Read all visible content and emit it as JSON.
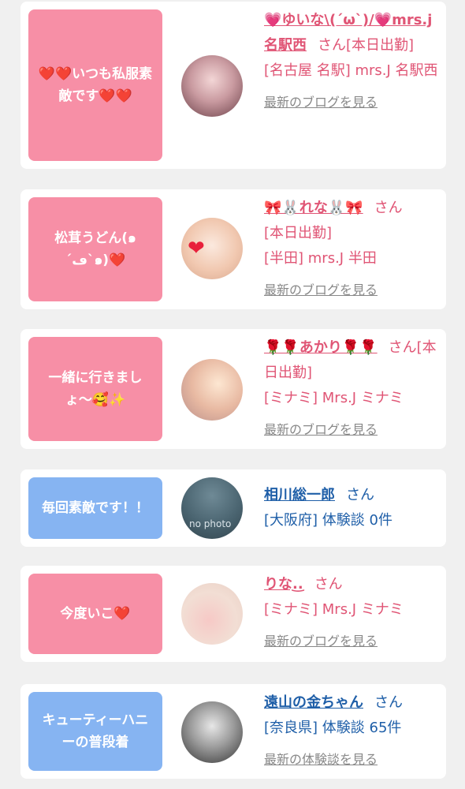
{
  "items": [
    {
      "message": "❤️❤️いつも私服素敵です❤️❤️",
      "name": "💗ゆいな\\(´ω`)/💗mrs.j名駅西",
      "honorific": "さん",
      "status": "[本日出勤]",
      "location": "[名古屋 名駅] mrs.J 名駅西",
      "link": "最新のブログを見る"
    },
    {
      "message": "松茸うどん(๑´ڡ`๑)❤️",
      "name": "🎀🐰れな🐰🎀",
      "honorific": "さん",
      "status": "[本日出勤]",
      "location": "[半田] mrs.J 半田",
      "link": "最新のブログを見る"
    },
    {
      "message": "一緒に行きましょ〜🥰✨",
      "name": "🌹🌹あかり🌹🌹",
      "honorific": "さん",
      "status": "[本日出勤]",
      "location": "[ミナミ] Mrs.J ミナミ",
      "link": "最新のブログを見る"
    },
    {
      "message": "毎回素敵です！！",
      "name": "相川総一郎",
      "honorific": "さん",
      "location": "[大阪府] 体験談 0件",
      "avatar_text": "no photo"
    },
    {
      "message": "今度いこ❤️",
      "name": "りな.͜.",
      "honorific": "さん",
      "location": "[ミナミ] Mrs.J ミナミ",
      "link": "最新のブログを見る"
    },
    {
      "message": "キューティーハニーの普段着",
      "name": "遠山の金ちゃん",
      "honorific": "さん",
      "location": "[奈良県] 体験談 65件",
      "link": "最新の体験談を見る"
    }
  ]
}
